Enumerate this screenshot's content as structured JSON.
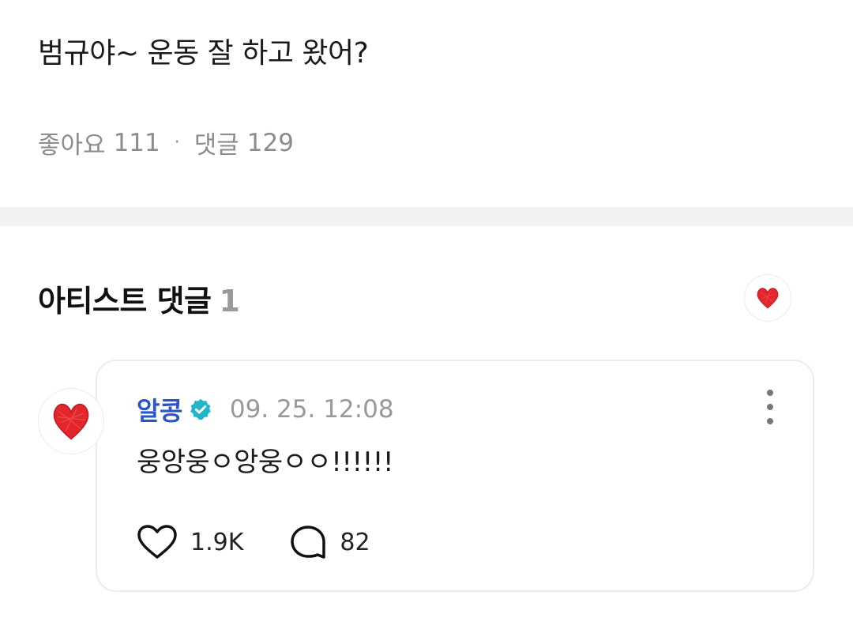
{
  "post": {
    "text": "범규야~ 운동 잘 하고 왔어?",
    "likes_label": "좋아요",
    "likes_count": "111",
    "separator": "·",
    "comments_label": "댓글",
    "comments_count": "129"
  },
  "artist_comments": {
    "title": "아티스트 댓글",
    "count": "1",
    "filter_icon": "red-heart-icon",
    "items": [
      {
        "author": "알콩",
        "verified": true,
        "verified_icon": "verified-badge-icon",
        "timestamp": "09. 25. 12:08",
        "text": "웅앙웅ㅇ앙웅ㅇㅇ!!!!!!",
        "avatar_icon": "red-heart-icon",
        "likes": "1.9K",
        "replies": "82",
        "like_icon": "heart-outline-icon",
        "reply_icon": "speech-bubble-icon",
        "more_icon": "more-vertical-icon"
      }
    ]
  },
  "colors": {
    "author_name": "#2a55c9",
    "verified_badge": "#1fb6c9",
    "heart_red": "#e3262b",
    "muted_text": "#8c8c8c",
    "divider": "#f2f2f2"
  }
}
